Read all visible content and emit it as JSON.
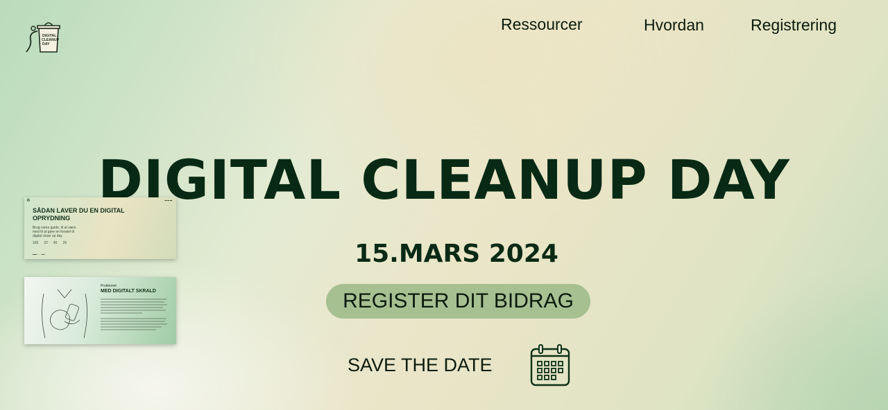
{
  "nav": {
    "resources": "Ressourcer",
    "how": "Hvordan",
    "registration": "Registrering"
  },
  "logo": {
    "line1": "DIGITAL",
    "line2": "CLEANUP",
    "line3": "DAY"
  },
  "hero": {
    "title": "DIGITAL CLEANUP DAY",
    "date": "15.MARS 2024",
    "register_button": "REGISTER DIT BIDRAG",
    "save_the_date": "SAVE THE DATE"
  },
  "thumbnails": [
    {
      "title": "SÅDAN LAVER DU EN DIGITAL OPRYDNING",
      "subtitle": "Brug vores guide, til at være med til at gøre en forskel til digital clean up day",
      "stats": [
        "166",
        "22",
        "45",
        "29"
      ]
    },
    {
      "label": "Problemet",
      "title": "MED DIGITALT SKRALD"
    }
  ],
  "colors": {
    "primary_text": "#082a14",
    "button_bg": "#a7c092"
  },
  "icons": {
    "logo": "trash-bin-logo-icon",
    "calendar": "calendar-icon"
  }
}
